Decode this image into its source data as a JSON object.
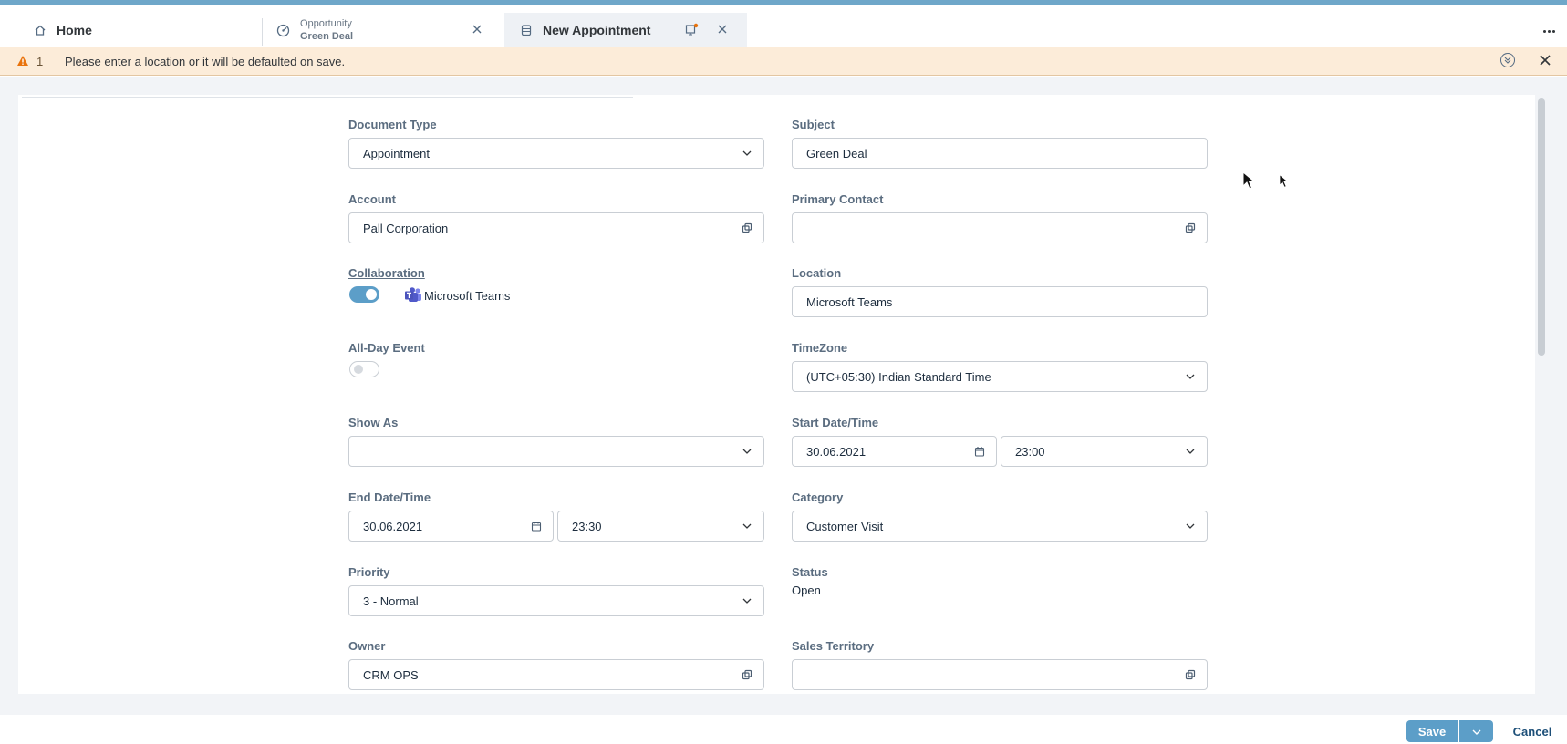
{
  "tabs": {
    "home": {
      "label": "Home",
      "icon": "home-icon"
    },
    "opportunity": {
      "label": "Opportunity",
      "sublabel": "Green Deal",
      "icon": "opportunity-icon"
    },
    "new_appointment": {
      "label": "New Appointment",
      "icon": "appointment-icon"
    }
  },
  "message_strip": {
    "count": "1",
    "text": "Please enter a location or it will be defaulted on save."
  },
  "form": {
    "document_type": {
      "label": "Document Type",
      "value": "Appointment"
    },
    "subject": {
      "label": "Subject",
      "value": "Green Deal"
    },
    "account": {
      "label": "Account",
      "value": "Pall Corporation"
    },
    "primary_contact": {
      "label": "Primary Contact",
      "value": ""
    },
    "collaboration": {
      "label": "Collaboration",
      "enabled": true,
      "provider": "Microsoft Teams"
    },
    "location": {
      "label": "Location",
      "value": "Microsoft Teams"
    },
    "all_day_event": {
      "label": "All-Day Event",
      "enabled": false
    },
    "timezone": {
      "label": "TimeZone",
      "value": "(UTC+05:30) Indian Standard Time"
    },
    "show_as": {
      "label": "Show As",
      "value": ""
    },
    "start": {
      "label": "Start Date/Time",
      "date": "30.06.2021",
      "time": "23:00"
    },
    "end": {
      "label": "End Date/Time",
      "date": "30.06.2021",
      "time": "23:30"
    },
    "category": {
      "label": "Category",
      "value": "Customer Visit"
    },
    "priority": {
      "label": "Priority",
      "value": "3 - Normal"
    },
    "status": {
      "label": "Status",
      "value": "Open"
    },
    "owner": {
      "label": "Owner",
      "value": "CRM OPS"
    },
    "sales_territory": {
      "label": "Sales Territory",
      "value": ""
    }
  },
  "footer": {
    "save_label": "Save",
    "cancel_label": "Cancel"
  },
  "colors": {
    "accent": "#5c9ec8",
    "warning_bg": "#fcecd9",
    "warning_icon": "#e9730c",
    "top_stripe": "#6fa7c9"
  }
}
